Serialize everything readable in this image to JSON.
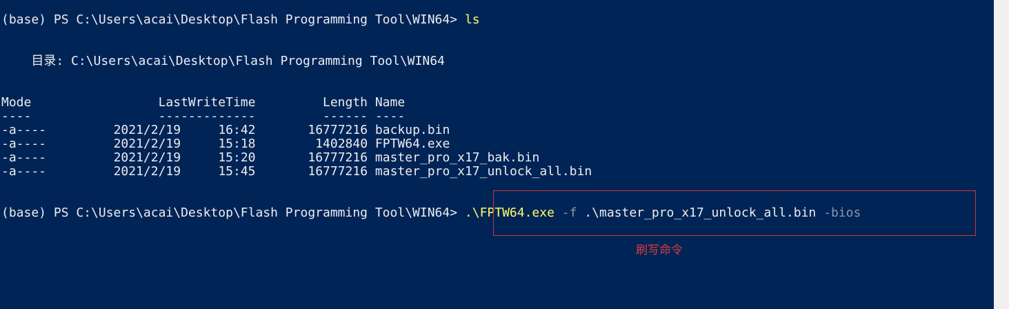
{
  "terminal": {
    "prompt1": {
      "prefix": "(base) PS C:\\Users\\acai\\Desktop\\Flash Programming Tool\\WIN64> ",
      "command": "ls"
    },
    "directory_line": "    目录: C:\\Users\\acai\\Desktop\\Flash Programming Tool\\WIN64",
    "listing_header": "Mode                 LastWriteTime         Length Name",
    "listing_underline": "----                 -------------         ------ ----",
    "files": [
      {
        "mode": "-a----",
        "date": "2021/2/19",
        "time": "16:42",
        "length": "16777216",
        "name": "backup.bin"
      },
      {
        "mode": "-a----",
        "date": "2021/2/19",
        "time": "15:18",
        "length": "1402840",
        "name": "FPTW64.exe"
      },
      {
        "mode": "-a----",
        "date": "2021/2/19",
        "time": "15:20",
        "length": "16777216",
        "name": "master_pro_x17_bak.bin"
      },
      {
        "mode": "-a----",
        "date": "2021/2/19",
        "time": "15:45",
        "length": "16777216",
        "name": "master_pro_x17_unlock_all.bin"
      }
    ],
    "prompt2": {
      "prefix": "(base) PS C:\\Users\\acai\\Desktop\\Flash Programming Tool\\WIN64> ",
      "command": ".\\FPTW64.exe",
      "flag1": "-f",
      "arg1": ".\\master_pro_x17_unlock_all.bin",
      "flag2": "-bios"
    }
  },
  "annotation": {
    "label": "刷写命令"
  },
  "colors": {
    "background": "#012456",
    "text": "#eeedf0",
    "command": "#ffff66",
    "parameter": "#8d96a8",
    "annotation": "#e03c3c"
  }
}
